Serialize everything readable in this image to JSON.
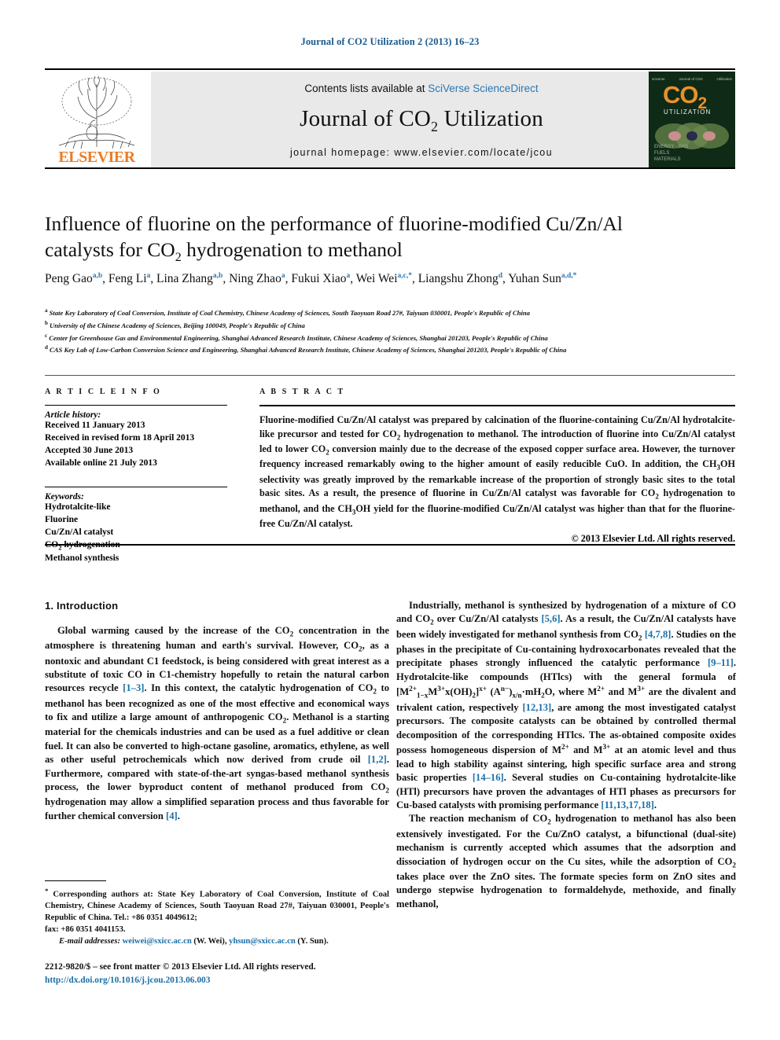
{
  "journal_ref": "Journal of CO2 Utilization 2 (2013) 16–23",
  "masthead": {
    "contents_prefix": "Contents lists available at ",
    "contents_link": "SciVerse ScienceDirect",
    "journal_name_part1": "Journal of CO",
    "journal_name_sub": "2",
    "journal_name_part2": " Utilization",
    "homepage": "journal homepage: www.elsevier.com/locate/jcou",
    "publisher": "ELSEVIER",
    "cover": {
      "co2": "CO",
      "co2_sub": "2",
      "utilization": "UTILIZATION",
      "top_left": "sciverse",
      "top_mid": "Journal of CO2",
      "top_right": "Utilization",
      "bottom_text": "ENERGY · GAS\nFUELS\nMATERIALS"
    }
  },
  "title": {
    "line1": "Influence of fluorine on the performance of fluorine-modified Cu/Zn/Al",
    "line2_a": "catalysts for CO",
    "line2_sub": "2",
    "line2_b": " hydrogenation to methanol"
  },
  "authors": [
    {
      "name": "Peng Gao",
      "sup": "a,b"
    },
    {
      "name": "Feng Li",
      "sup": "a"
    },
    {
      "name": "Lina Zhang",
      "sup": "a,b"
    },
    {
      "name": "Ning Zhao",
      "sup": "a"
    },
    {
      "name": "Fukui Xiao",
      "sup": "a"
    },
    {
      "name": "Wei Wei",
      "sup": "a,c,*"
    },
    {
      "name": "Liangshu Zhong",
      "sup": "d"
    },
    {
      "name": "Yuhan Sun",
      "sup": "a,d,*"
    }
  ],
  "affiliations": [
    {
      "mark": "a",
      "text": "State Key Laboratory of Coal Conversion, Institute of Coal Chemistry, Chinese Academy of Sciences, South Taoyuan Road 27#, Taiyuan 030001, People's Republic of China"
    },
    {
      "mark": "b",
      "text": "University of the Chinese Academy of Sciences, Beijing 100049, People's Republic of China"
    },
    {
      "mark": "c",
      "text": "Center for Greenhouse Gas and Environmental Engineering, Shanghai Advanced Research Institute, Chinese Academy of Sciences, Shanghai 201203, People's Republic of China"
    },
    {
      "mark": "d",
      "text": "CAS Key Lab of Low-Carbon Conversion Science and Engineering, Shanghai Advanced Research Institute, Chinese Academy of Sciences, Shanghai 201203, People's Republic of China"
    }
  ],
  "article_info": {
    "label": "A R T I C L E    I N F O",
    "history_heading": "Article history:",
    "history": [
      "Received 11 January 2013",
      "Received in revised form 18 April 2013",
      "Accepted 30 June 2013",
      "Available online 21 July 2013"
    ],
    "keywords_heading": "Keywords:",
    "keywords": [
      "Hydrotalcite-like",
      "Fluorine",
      "Cu/Zn/Al catalyst",
      "CO2 hydrogenation",
      "Methanol synthesis"
    ]
  },
  "abstract": {
    "label": "A B S T R A C T",
    "text": "Fluorine-modified Cu/Zn/Al catalyst was prepared by calcination of the fluorine-containing Cu/Zn/Al hydrotalcite-like precursor and tested for CO2 hydrogenation to methanol. The introduction of fluorine into Cu/Zn/Al catalyst led to lower CO2 conversion mainly due to the decrease of the exposed copper surface area. However, the turnover frequency increased remarkably owing to the higher amount of easily reducible CuO. In addition, the CH3OH selectivity was greatly improved by the remarkable increase of the proportion of strongly basic sites to the total basic sites. As a result, the presence of fluorine in Cu/Zn/Al catalyst was favorable for CO2 hydrogenation to methanol, and the CH3OH yield for the fluorine-modified Cu/Zn/Al catalyst was higher than that for the fluorine-free Cu/Zn/Al catalyst.",
    "copyright": "© 2013 Elsevier Ltd. All rights reserved."
  },
  "body": {
    "section_heading": "1. Introduction",
    "left_paragraph_1": "Global warming caused by the increase of the CO2 concentration in the atmosphere is threatening human and earth's survival. However, CO2, as a nontoxic and abundant C1 feedstock, is being considered with great interest as a substitute of toxic CO in C1-chemistry hopefully to retain the natural carbon resources recycle [1–3]. In this context, the catalytic hydrogenation of CO2 to methanol has been recognized as one of the most effective and economical ways to fix and utilize a large amount of anthropogenic CO2. Methanol is a starting material for the chemicals industries and can be used as a fuel additive or clean fuel. It can also be converted to high-octane gasoline, aromatics, ethylene, as well as other useful petrochemicals which now derived from crude oil [1,2]. Furthermore, compared with state-of-the-art syngas-based methanol synthesis process, the lower byproduct content of methanol produced from CO2 hydrogenation may allow a simplified separation process and thus favorable for further chemical conversion [4].",
    "right_paragraph_1": "Industrially, methanol is synthesized by hydrogenation of a mixture of CO and CO2 over Cu/Zn/Al catalysts [5,6]. As a result, the Cu/Zn/Al catalysts have been widely investigated for methanol synthesis from CO2 [4,7,8]. Studies on the phases in the precipitate of Cu-containing hydroxocarbonates revealed that the precipitate phases strongly influenced the catalytic performance [9–11]. Hydrotalcite-like compounds (HTlcs) with the general formula of [M2+1−xM3+x(OH)2]x+ (An−)x/n·mH2O, where M2+ and M3+ are the divalent and trivalent cation, respectively [12,13], are among the most investigated catalyst precursors. The composite catalysts can be obtained by controlled thermal decomposition of the corresponding HTlcs. The as-obtained composite oxides possess homogeneous dispersion of M2+ and M3+ at an atomic level and thus lead to high stability against sintering, high specific surface area and strong basic properties [14–16]. Several studies on Cu-containing hydrotalcite-like (HTl) precursors have proven the advantages of HTl phases as precursors for Cu-based catalysts with promising performance [11,13,17,18].",
    "right_paragraph_2": "The reaction mechanism of CO2 hydrogenation to methanol has also been extensively investigated. For the Cu/ZnO catalyst, a bifunctional (dual-site) mechanism is currently accepted which assumes that the adsorption and dissociation of hydrogen occur on the Cu sites, while the adsorption of CO2 takes place over the ZnO sites. The formate species form on ZnO sites and undergo stepwise hydrogenation to formaldehyde, methoxide, and finally methanol,"
  },
  "footnote": {
    "marker": "*",
    "text": "Corresponding authors at: State Key Laboratory of Coal Conversion, Institute of Coal Chemistry, Chinese Academy of Sciences, South Taoyuan Road 27#, Taiyuan 030001, People's Republic of China. Tel.: +86 0351 4049612;",
    "fax": "fax: +86 0351 4041153.",
    "email_label": "E-mail addresses:",
    "email1": "weiwei@sxicc.ac.cn",
    "email1_who": "(W. Wei),",
    "email2": "yhsun@sxicc.ac.cn",
    "email2_who": "(Y. Sun)."
  },
  "footer": {
    "issn_line": "2212-9820/$ – see front matter © 2013 Elsevier Ltd. All rights reserved.",
    "doi": "http://dx.doi.org/10.1016/j.jcou.2013.06.003"
  },
  "colors": {
    "link_blue": "#1a6fa8",
    "header_blue": "#1a5a8e",
    "elsevier_orange": "#ec7c24",
    "cover_green": "#0f2a17",
    "band_grey": "#e9e9e9"
  }
}
